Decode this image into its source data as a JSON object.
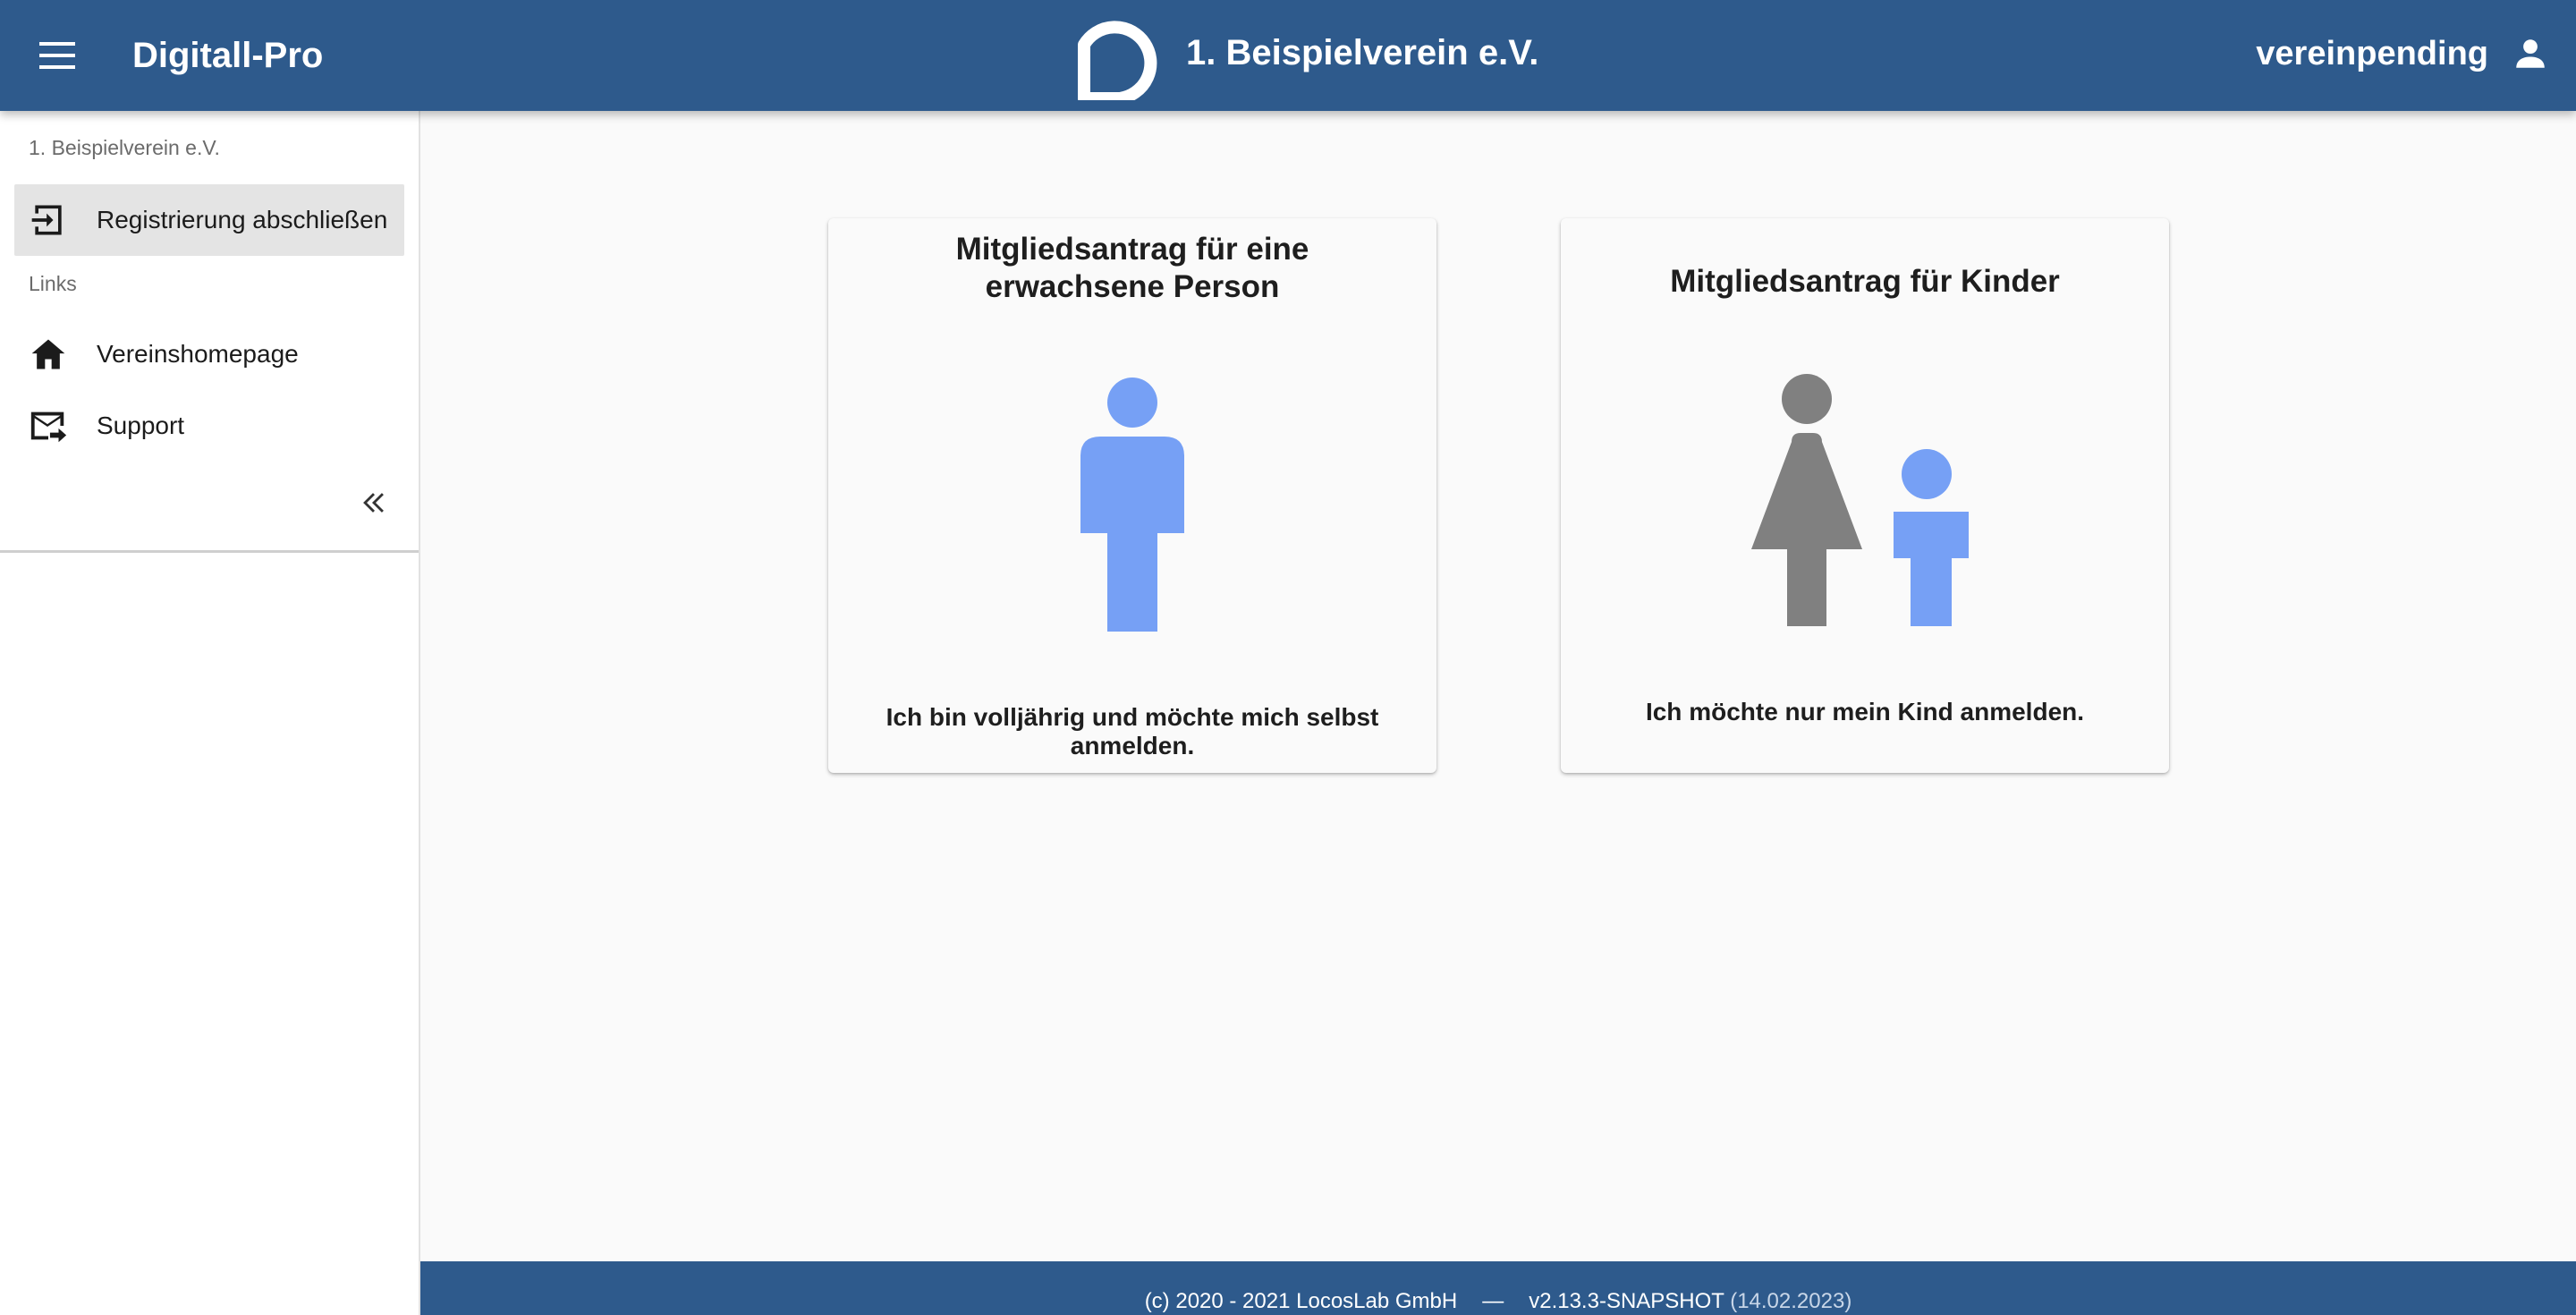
{
  "header": {
    "app_title": "Digitall-Pro",
    "org_name": "1. Beispielverein e.V.",
    "username": "vereinpending",
    "icons": {
      "menu": "menu-icon",
      "logo": "brand-logo",
      "user": "person-icon"
    }
  },
  "sidebar": {
    "org_label": "1. Beispielverein e.V.",
    "registration_item": {
      "label": "Registrierung abschließen",
      "icon": "login-icon"
    },
    "links_label": "Links",
    "links": [
      {
        "label": "Vereinshomepage",
        "icon": "home-icon"
      },
      {
        "label": "Support",
        "icon": "forward-mail-icon"
      }
    ],
    "collapse_icon": "double-chevron-left-icon"
  },
  "cards": [
    {
      "title_line1": "Mitgliedsantrag für eine",
      "title_line2": "erwachsene Person",
      "text_line1": "Ich bin volljährig und möchte mich selbst",
      "text_line2": "anmelden.",
      "icon": "adult-person-icon"
    },
    {
      "title": "Mitgliedsantrag für Kinder",
      "text": "Ich möchte nur mein Kind anmelden.",
      "icon": "parent-child-icon"
    }
  ],
  "footer": {
    "copyright": "(c) 2020 - 2021 LocosLab GmbH",
    "separator": "—",
    "version": "v2.13.3-SNAPSHOT",
    "date": "(14.02.2023)"
  },
  "colors": {
    "primary": "#2e5a8c",
    "figure_blue": "#76a0f5",
    "figure_gray": "#808080",
    "background": "#fafafa"
  }
}
